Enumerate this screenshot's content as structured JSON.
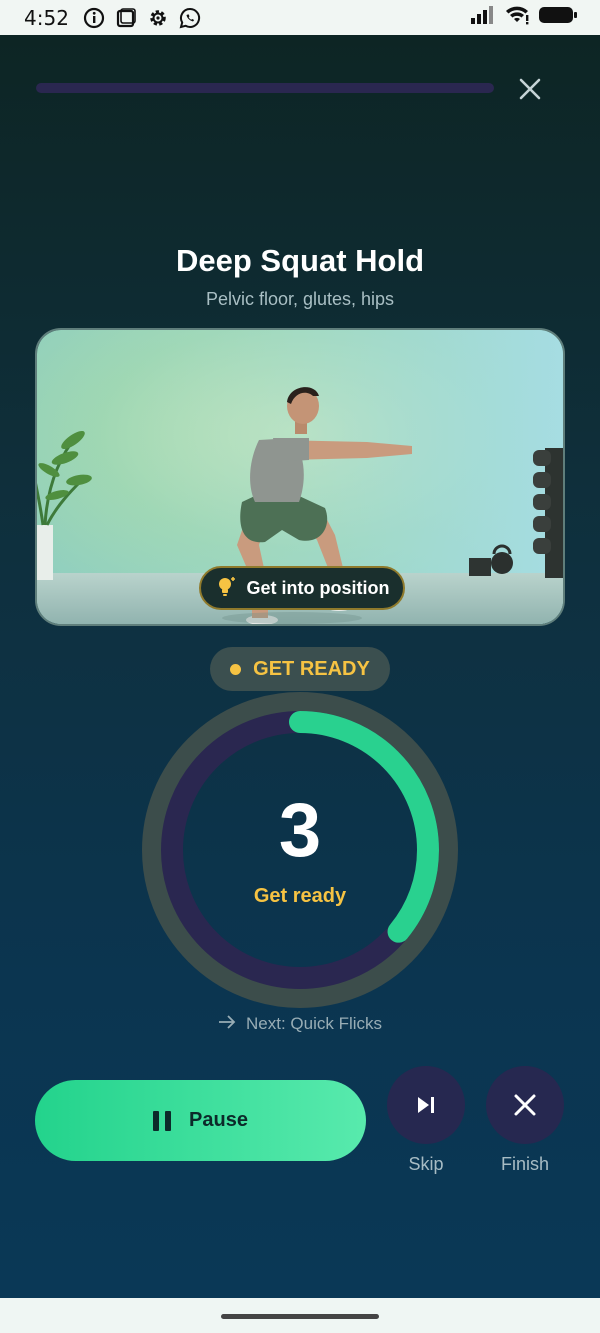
{
  "status": {
    "time": "4:52",
    "icons": [
      "info-icon",
      "square-icon",
      "gear-icon",
      "whatsapp-icon"
    ],
    "right_icons": [
      "signal-icon",
      "wifi-icon",
      "battery-icon"
    ]
  },
  "workout": {
    "progress": 0.0,
    "title": "Deep Squat Hold",
    "subtitle": "Pelvic floor, glutes, hips",
    "hint": "Get into position",
    "phase": "GET READY",
    "countdown": "3",
    "countdown_label": "Get ready",
    "timer_progress": 0.36,
    "next": "Next: Quick Flicks"
  },
  "controls": {
    "pause_label": "Pause",
    "skip_label": "Skip",
    "finish_label": "Finish"
  },
  "colors": {
    "accent": "#29d18f",
    "warning": "#f6c343",
    "ring_track": "#2a2750",
    "ring_outer": "#3c4d4b"
  }
}
